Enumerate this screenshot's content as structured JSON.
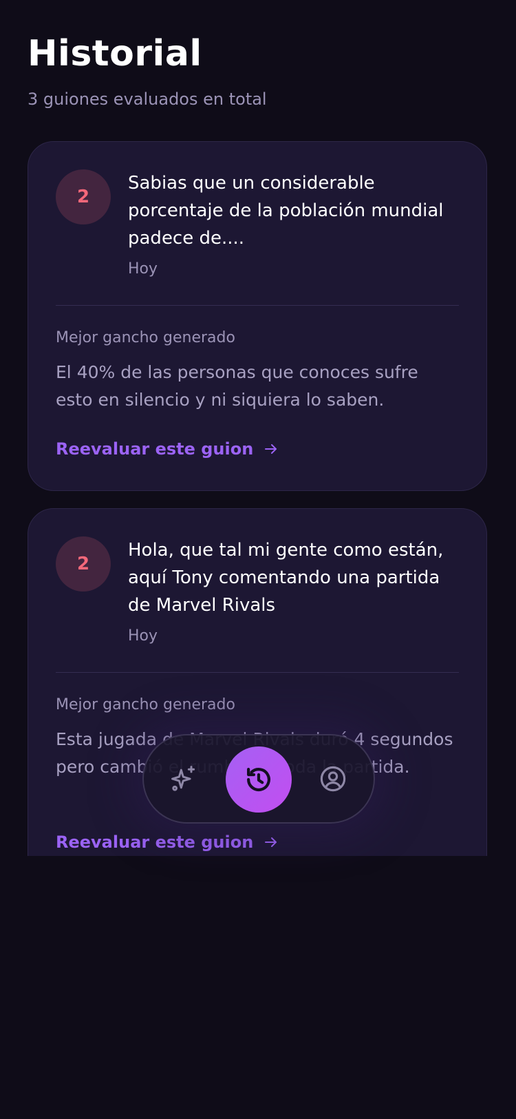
{
  "header": {
    "title": "Historial",
    "subtitle": "3 guiones evaluados en total"
  },
  "cards": [
    {
      "score": "2",
      "title": "Sabias que un considerable porcentaje de la población mundial padece de....",
      "date": "Hoy",
      "section_label": "Mejor gancho generado",
      "hook": "El 40% de las personas que conoces sufre esto en silencio y ni siquiera lo saben.",
      "action_label": "Reevaluar este guion"
    },
    {
      "score": "2",
      "title": "Hola, que tal mi gente como están, aquí Tony comentando una partida de Marvel Rivals",
      "date": "Hoy",
      "section_label": "Mejor gancho generado",
      "hook": "Esta jugada de Marvel Rivals duró 4 segundos pero cambió el rumbo de toda la partida.",
      "action_label": "Reevaluar este guion"
    }
  ],
  "nav": {
    "items": [
      {
        "icon": "sparkles-icon",
        "active": false
      },
      {
        "icon": "history-icon",
        "active": true
      },
      {
        "icon": "user-circle-icon",
        "active": false
      }
    ]
  },
  "colors": {
    "background": "#0f0c18",
    "card": "#1d1733",
    "accent": "#9b63f5",
    "score_badge_bg": "#43253f",
    "score_badge_text": "#f4687a",
    "nav_active_gradient_start": "#a560f4",
    "nav_active_gradient_end": "#c24ef0"
  }
}
